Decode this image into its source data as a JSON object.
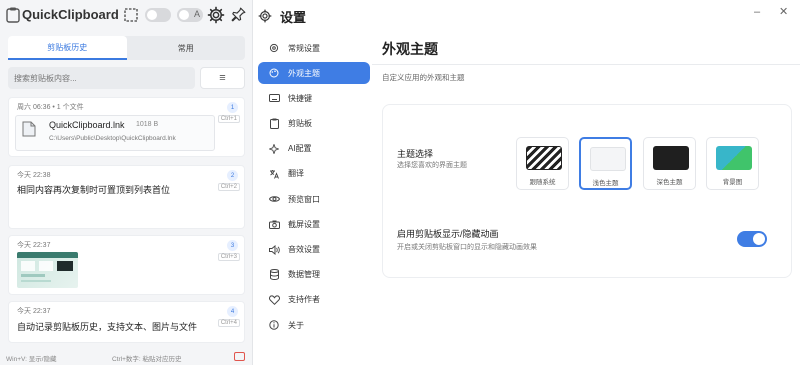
{
  "clipboard_window": {
    "title": "QuickClipboard",
    "tabs": [
      {
        "label": "剪贴板历史",
        "active": true
      },
      {
        "label": "常用",
        "active": false
      }
    ],
    "search": {
      "placeholder": "搜索剪贴板内容..."
    },
    "menu_icon": "≡",
    "items": [
      {
        "meta": "周六 06:36 • 1 个文件",
        "index": "1",
        "shortcut": "Ctrl+1",
        "file": {
          "name": "QuickClipboard.lnk",
          "size": "1018 B",
          "path": "C:\\Users\\Public\\Desktop\\QuickClipboard.lnk"
        }
      },
      {
        "meta": "今天 22:38",
        "index": "2",
        "shortcut": "Ctrl+2",
        "text": "相同内容再次复制时可置顶到列表首位"
      },
      {
        "meta": "今天 22:37",
        "index": "3",
        "shortcut": "Ctrl+3",
        "image": true
      },
      {
        "meta": "今天 22:37",
        "index": "4",
        "shortcut": "Ctrl+4",
        "text": "自动记录剪贴板历史，支持文本、图片与文件"
      }
    ],
    "status": {
      "left": "Win+V: 显示/隐藏",
      "middle": "Ctrl+数字: 粘贴对应历史"
    }
  },
  "settings_window": {
    "title": "设置",
    "nav": [
      {
        "label": "常规设置",
        "icon": "gear-icon",
        "active": false
      },
      {
        "label": "外观主题",
        "icon": "palette-icon",
        "active": true
      },
      {
        "label": "快捷键",
        "icon": "keyboard-icon",
        "active": false
      },
      {
        "label": "剪贴板",
        "icon": "clipboard-icon",
        "active": false
      },
      {
        "label": "AI配置",
        "icon": "ai-icon",
        "active": false
      },
      {
        "label": "翻译",
        "icon": "translate-icon",
        "active": false
      },
      {
        "label": "预览窗口",
        "icon": "eye-icon",
        "active": false
      },
      {
        "label": "截屏设置",
        "icon": "camera-icon",
        "active": false
      },
      {
        "label": "音效设置",
        "icon": "speaker-icon",
        "active": false
      },
      {
        "label": "数据管理",
        "icon": "database-icon",
        "active": false
      },
      {
        "label": "支持作者",
        "icon": "heart-icon",
        "active": false
      },
      {
        "label": "关于",
        "icon": "info-icon",
        "active": false
      }
    ],
    "content": {
      "title": "外观主题",
      "subtitle": "自定义应用的外观和主题",
      "theme": {
        "label": "主题选择",
        "description": "选择您喜欢的界面主题",
        "options": [
          {
            "label": "跟随系统",
            "selected": false
          },
          {
            "label": "浅色主题",
            "selected": true
          },
          {
            "label": "深色主题",
            "selected": false
          },
          {
            "label": "背景图",
            "selected": false
          }
        ]
      },
      "animation": {
        "label": "启用剪贴板显示/隐藏动画",
        "description": "开启或关闭剪贴板窗口的显示和隐藏动画效果",
        "enabled": true
      }
    },
    "window_controls": {
      "minimize": "–",
      "close": "✕"
    }
  },
  "colors": {
    "accent": "#3f7de4",
    "panel_bg": "#f4f5f7"
  }
}
